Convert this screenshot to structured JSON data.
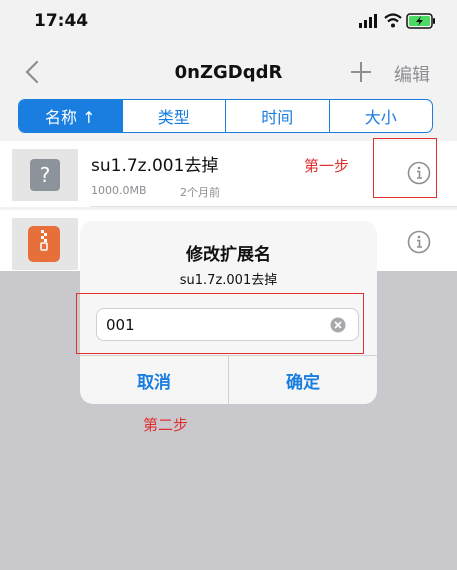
{
  "status_bar": {
    "time": "17:44"
  },
  "nav": {
    "title": "0nZGDqdR",
    "edit_label": "编辑"
  },
  "sort_tabs": [
    {
      "label": "名称 ↑",
      "selected": true
    },
    {
      "label": "类型",
      "selected": false
    },
    {
      "label": "时间",
      "selected": false
    },
    {
      "label": "大小",
      "selected": false
    }
  ],
  "files": [
    {
      "name": "su1.7z.001去掉",
      "size": "1000.0MB",
      "date": "2个月前",
      "icon": "unknown-file-icon"
    },
    {
      "name": "",
      "size": "",
      "date": "",
      "icon": "zip-file-icon"
    }
  ],
  "dialog": {
    "title": "修改扩展名",
    "message": "su1.7z.001去掉",
    "input_value": "001",
    "cancel_label": "取消",
    "ok_label": "确定"
  },
  "annotations": {
    "step1": "第一步",
    "step2": "第二步"
  },
  "colors": {
    "accent": "#1a7de0",
    "annotation": "#e03131",
    "dim": "#c9c9cd"
  }
}
